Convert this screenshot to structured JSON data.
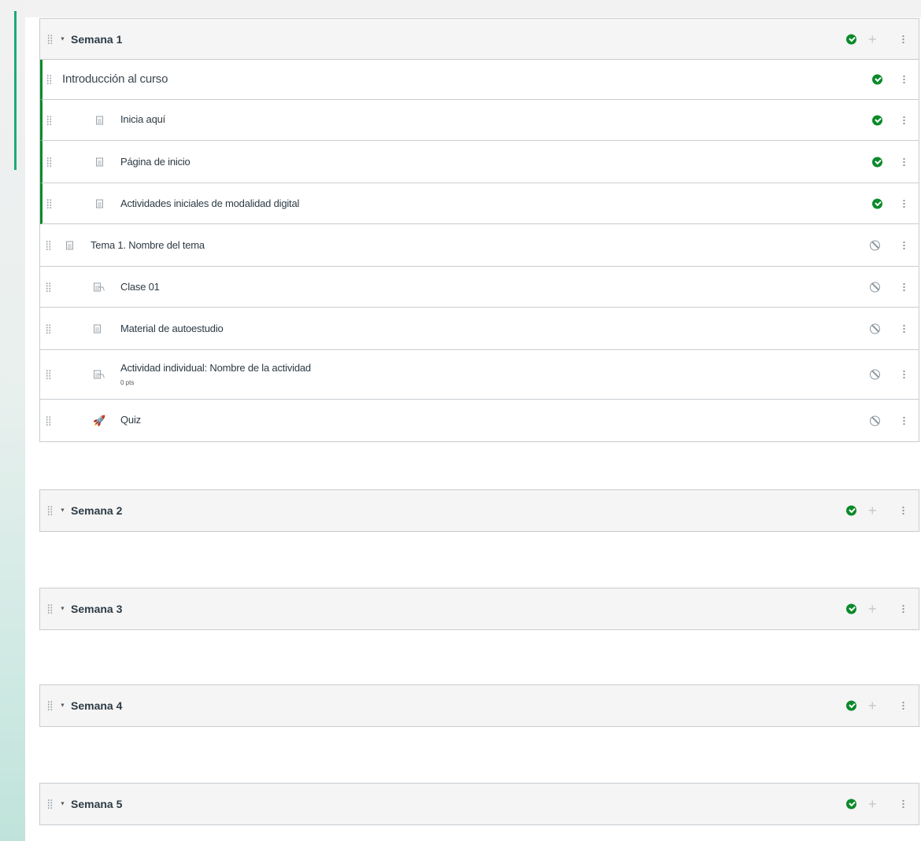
{
  "modules": [
    {
      "title": "Semana 1",
      "published": true,
      "items": [
        {
          "title": "Introducción al curso",
          "type": "header",
          "published": true,
          "indent": 0
        },
        {
          "title": "Inicia aquí",
          "type": "page",
          "published": true,
          "indent": 1
        },
        {
          "title": "Página de inicio",
          "type": "page",
          "published": true,
          "indent": 1
        },
        {
          "title": "Actividades iniciales de modalidad digital",
          "type": "page",
          "published": true,
          "indent": 1
        },
        {
          "title": "Tema 1. Nombre del tema",
          "type": "page",
          "published": false,
          "indent": 0
        },
        {
          "title": "Clase 01",
          "type": "assignment",
          "published": false,
          "indent": 1
        },
        {
          "title": "Material de autoestudio",
          "type": "page",
          "published": false,
          "indent": 1
        },
        {
          "title": "Actividad individual: Nombre de la actividad",
          "subtitle": "0 pts",
          "type": "assignment",
          "published": false,
          "indent": 1
        },
        {
          "title": "Quiz",
          "type": "quiz",
          "published": false,
          "indent": 1
        }
      ]
    },
    {
      "title": "Semana 2",
      "published": true,
      "items": []
    },
    {
      "title": "Semana 3",
      "published": true,
      "items": []
    },
    {
      "title": "Semana 4",
      "published": true,
      "items": []
    },
    {
      "title": "Semana 5",
      "published": true,
      "items": []
    }
  ],
  "colors": {
    "published": "#0b8a2a",
    "unpublished": "#8b969e",
    "accent": "#1aaa7a"
  },
  "icons": {
    "drag": "drag-handle-icon",
    "caret": "caret-down-icon",
    "published": "published-check-icon",
    "unpublished": "unpublished-icon",
    "add": "add-icon",
    "menu": "kebab-menu-icon",
    "page": "page-icon",
    "assignment": "assignment-icon",
    "quiz": "quiz-icon"
  }
}
